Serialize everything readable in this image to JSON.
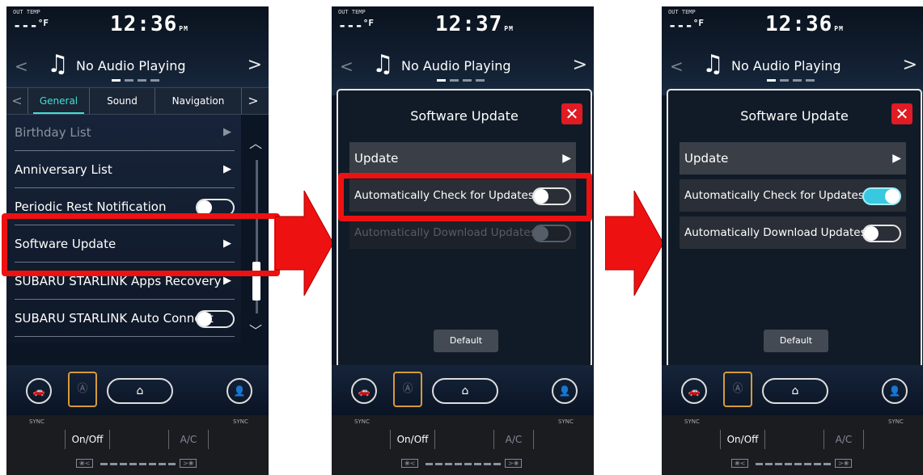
{
  "status": {
    "out_temp_label": "OUT TEMP",
    "temp_value": "---",
    "temp_unit": "°F"
  },
  "screens": [
    {
      "time": "12:36",
      "ampm": "PM"
    },
    {
      "time": "12:37",
      "ampm": "PM"
    },
    {
      "time": "12:36",
      "ampm": "PM"
    }
  ],
  "audio": {
    "title": "No Audio Playing",
    "prev": "<",
    "next": ">",
    "icon": "music-note-icon"
  },
  "tabs": {
    "prev": "<",
    "next": ">",
    "items": [
      "General",
      "Sound",
      "Navigation"
    ],
    "active": "General"
  },
  "settings_list": [
    {
      "label": "Birthday List",
      "control": "chevron",
      "dim": true
    },
    {
      "label": "Anniversary List",
      "control": "chevron"
    },
    {
      "label": "Periodic Rest Notification",
      "control": "toggle",
      "on": false
    },
    {
      "label": "Software Update",
      "control": "chevron",
      "highlighted": true
    },
    {
      "label": "SUBARU STARLINK Apps Recovery",
      "control": "chevron"
    },
    {
      "label": "SUBARU STARLINK Auto Connect",
      "control": "toggle",
      "on": false
    }
  ],
  "dialog": {
    "title": "Software Update",
    "close": "✕",
    "update_label": "Update",
    "auto_check_label": "Automatically Check for Updates",
    "auto_download_label": "Automatically Download Updates",
    "default_label": "Default"
  },
  "dialog_states": [
    {
      "auto_check_on": false,
      "auto_download_enabled": false,
      "auto_download_on": false
    },
    {
      "auto_check_on": true,
      "auto_download_enabled": true,
      "auto_download_on": false
    }
  ],
  "climate": {
    "sync_label": "SYNC",
    "onoff_label": "On/Off",
    "ac_label": "A/C",
    "fan_down": "❀<",
    "fan_up": ">❀"
  },
  "dock": {
    "a_label": "Ⓐ",
    "home_icon": "⌂"
  },
  "colors": {
    "highlight": "#ee1111",
    "arrow": "#ee1111",
    "toggle_on": "#38c8e0",
    "active_tab": "#3fe0d6"
  }
}
